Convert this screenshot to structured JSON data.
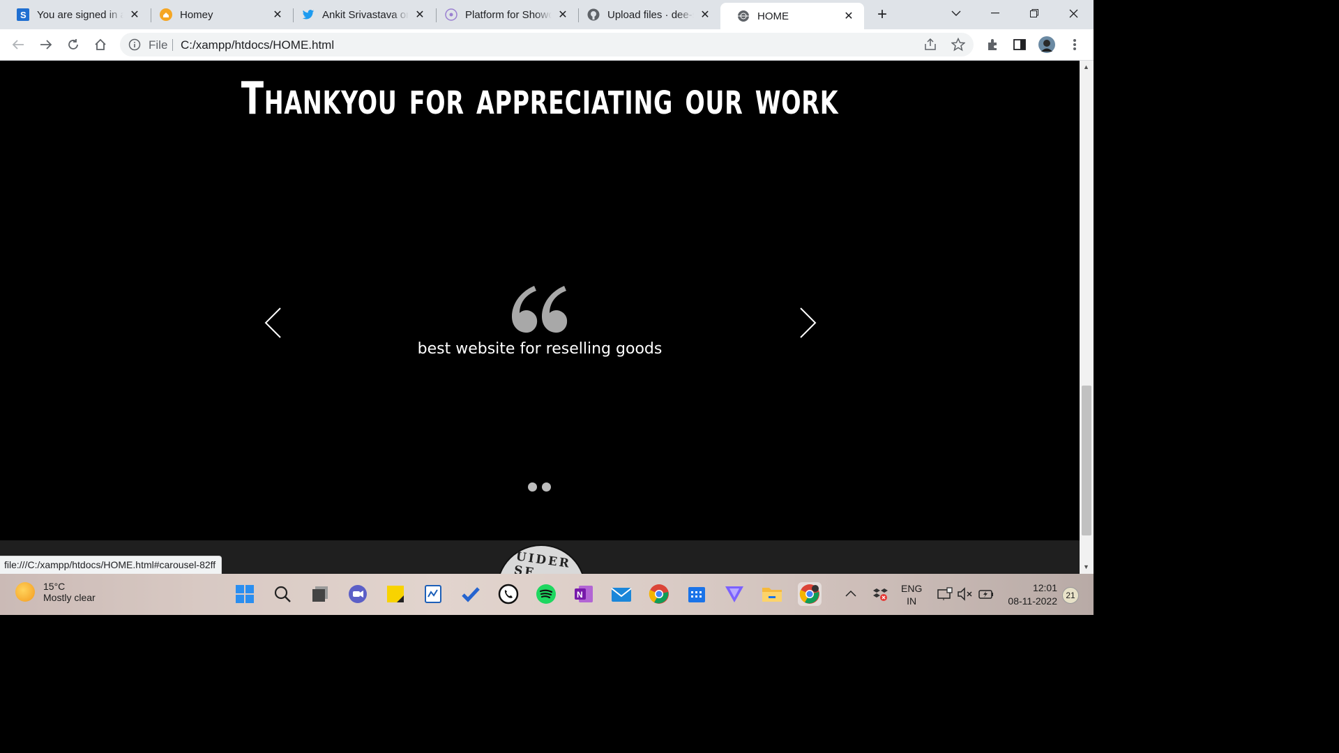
{
  "browser": {
    "tabs": [
      {
        "title": "You are signed in as",
        "favicon": "s-app-icon",
        "favcolor": "#1f6fd1"
      },
      {
        "title": "Homey",
        "favicon": "homey-icon",
        "favcolor": "#f5a623"
      },
      {
        "title": "Ankit Srivastava on",
        "favicon": "twitter-icon",
        "favcolor": "#1d9bf0"
      },
      {
        "title": "Platform for Showcase",
        "favicon": "platform-icon",
        "favcolor": "#9a7fd1"
      },
      {
        "title": "Upload files · dee-st",
        "favicon": "github-icon",
        "favcolor": "#5f6368"
      },
      {
        "title": "HOME",
        "favicon": "globe-icon",
        "favcolor": "#5f6368"
      }
    ],
    "omnibox": {
      "scheme_label": "File",
      "url": "C:/xampp/htdocs/HOME.html"
    }
  },
  "page": {
    "heading": "Thankyou for appreciating our work",
    "testimonial": "best website for reselling goods",
    "seal_text": "UIDER SE"
  },
  "status_url": "file:///C:/xampp/htdocs/HOME.html#carousel-82ff",
  "taskbar": {
    "weather_temp": "15°C",
    "weather_desc": "Mostly clear",
    "lang": "ENG",
    "region": "IN",
    "time": "12:01",
    "date": "08-11-2022",
    "notification_count": "21",
    "apps": [
      "start-icon",
      "search-icon",
      "task-view-icon",
      "teams-icon",
      "sticky-notes-icon",
      "whiteboard-icon",
      "todo-icon",
      "whatsapp-icon",
      "spotify-icon",
      "onenote-icon",
      "mail-icon",
      "chrome-icon",
      "calendar-icon",
      "vpn-icon",
      "file-explorer-icon",
      "chrome-profile-icon"
    ]
  },
  "colors": {
    "page_bg": "#000000",
    "tab_strip": "#dfe3e8",
    "accent": "#1a73e8"
  }
}
